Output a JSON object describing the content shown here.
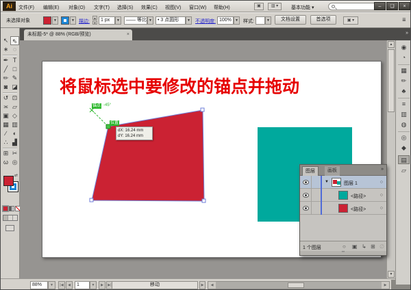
{
  "menubar": {
    "logo": "Ai",
    "menus": [
      "文件(F)",
      "编辑(E)",
      "对象(O)",
      "文字(T)",
      "选择(S)",
      "效果(C)",
      "视图(V)",
      "窗口(W)",
      "帮助(H)"
    ],
    "bridge_icon": "▣",
    "arrange_icon": "▥",
    "workspace": "基本功能",
    "window_buttons": {
      "minimize": "–",
      "restore": "❏",
      "close": "×"
    }
  },
  "controlbar": {
    "no_selection": "未选择对象",
    "stroke_label": "描边:",
    "stroke_value": "1 px",
    "profile_value": "等比",
    "brush_value": "• 3 点圆形",
    "opacity_label": "不透明度:",
    "opacity_value": "100%",
    "style_label": "样式:",
    "doc_setup": "文档设置",
    "preferences": "首选项"
  },
  "document_tab": {
    "title": "未标题-5* @ 88% (RGB/预览)",
    "close": "×"
  },
  "toolbar": {
    "tools": [
      {
        "name": "selection-tool",
        "glyph": "↖"
      },
      {
        "name": "direct-selection-tool",
        "glyph": "⇖"
      },
      {
        "name": "magic-wand-tool",
        "glyph": "∗"
      },
      {
        "name": "lasso-tool",
        "glyph": "◌"
      },
      {
        "name": "pen-tool",
        "glyph": "✒"
      },
      {
        "name": "type-tool",
        "glyph": "T"
      },
      {
        "name": "line-tool",
        "glyph": "╱"
      },
      {
        "name": "rectangle-tool",
        "glyph": "□"
      },
      {
        "name": "paintbrush-tool",
        "glyph": "✏"
      },
      {
        "name": "pencil-tool",
        "glyph": "✎"
      },
      {
        "name": "blob-brush-tool",
        "glyph": "◙"
      },
      {
        "name": "eraser-tool",
        "glyph": "◪"
      },
      {
        "name": "rotate-tool",
        "glyph": "↺"
      },
      {
        "name": "scale-tool",
        "glyph": "⊡"
      },
      {
        "name": "width-tool",
        "glyph": "≍"
      },
      {
        "name": "free-transform-tool",
        "glyph": "▱"
      },
      {
        "name": "shape-builder-tool",
        "glyph": "▣"
      },
      {
        "name": "perspective-grid-tool",
        "glyph": "◇"
      },
      {
        "name": "mesh-tool",
        "glyph": "▦"
      },
      {
        "name": "gradient-tool",
        "glyph": "▥"
      },
      {
        "name": "eyedropper-tool",
        "glyph": "∕"
      },
      {
        "name": "blend-tool",
        "glyph": "◐"
      },
      {
        "name": "symbol-sprayer-tool",
        "glyph": "∴"
      },
      {
        "name": "column-graph-tool",
        "glyph": "▟"
      },
      {
        "name": "artboard-tool",
        "glyph": "⊞"
      },
      {
        "name": "slice-tool",
        "glyph": "✂"
      },
      {
        "name": "hand-tool",
        "glyph": "ω"
      },
      {
        "name": "zoom-tool",
        "glyph": "◎"
      }
    ]
  },
  "canvas": {
    "heading": "将鼠标选中要修改的锚点并拖动",
    "anchor_label": "锚点",
    "anchor_angle": "-45°",
    "position_label": "位置",
    "tooltip_line1": "dX: 16.24 mm",
    "tooltip_line2": "dY: 16.24 mm",
    "colors": {
      "red_shape": "#cb2233",
      "teal_shape": "#00a99d",
      "selection": "#6e7ed8",
      "smart_guide": "#2db82d",
      "heading": "#e60000"
    }
  },
  "layers_panel": {
    "tabs": {
      "layers": "图层",
      "artboards": "画板"
    },
    "collapse_icon": "»",
    "rows": [
      {
        "name": "图层 1"
      },
      {
        "name": "<路径>"
      },
      {
        "name": "<路径>"
      }
    ],
    "status": "1 个图层",
    "footer_icons": {
      "locate": "○",
      "mask": "▣",
      "new_sublayer": "↳",
      "new_layer": "⊞",
      "delete": "∅"
    }
  },
  "dock": {
    "panels": [
      {
        "name": "color",
        "glyph": "◉"
      },
      {
        "name": "color-guide",
        "glyph": "◔"
      },
      {
        "name": "swatches",
        "glyph": "▦"
      },
      {
        "name": "brushes",
        "glyph": "✏"
      },
      {
        "name": "symbols",
        "glyph": "♣"
      },
      {
        "name": "stroke",
        "glyph": "≡"
      },
      {
        "name": "gradient",
        "glyph": "▥"
      },
      {
        "name": "transparency",
        "glyph": "◍"
      },
      {
        "name": "appearance",
        "glyph": "◎"
      },
      {
        "name": "graphic-styles",
        "glyph": "◆"
      },
      {
        "name": "layers",
        "glyph": "▤"
      },
      {
        "name": "artboards",
        "glyph": "▱"
      }
    ]
  },
  "statusbar": {
    "zoom": "88%",
    "artboard_number": "1",
    "tool": "移动"
  }
}
